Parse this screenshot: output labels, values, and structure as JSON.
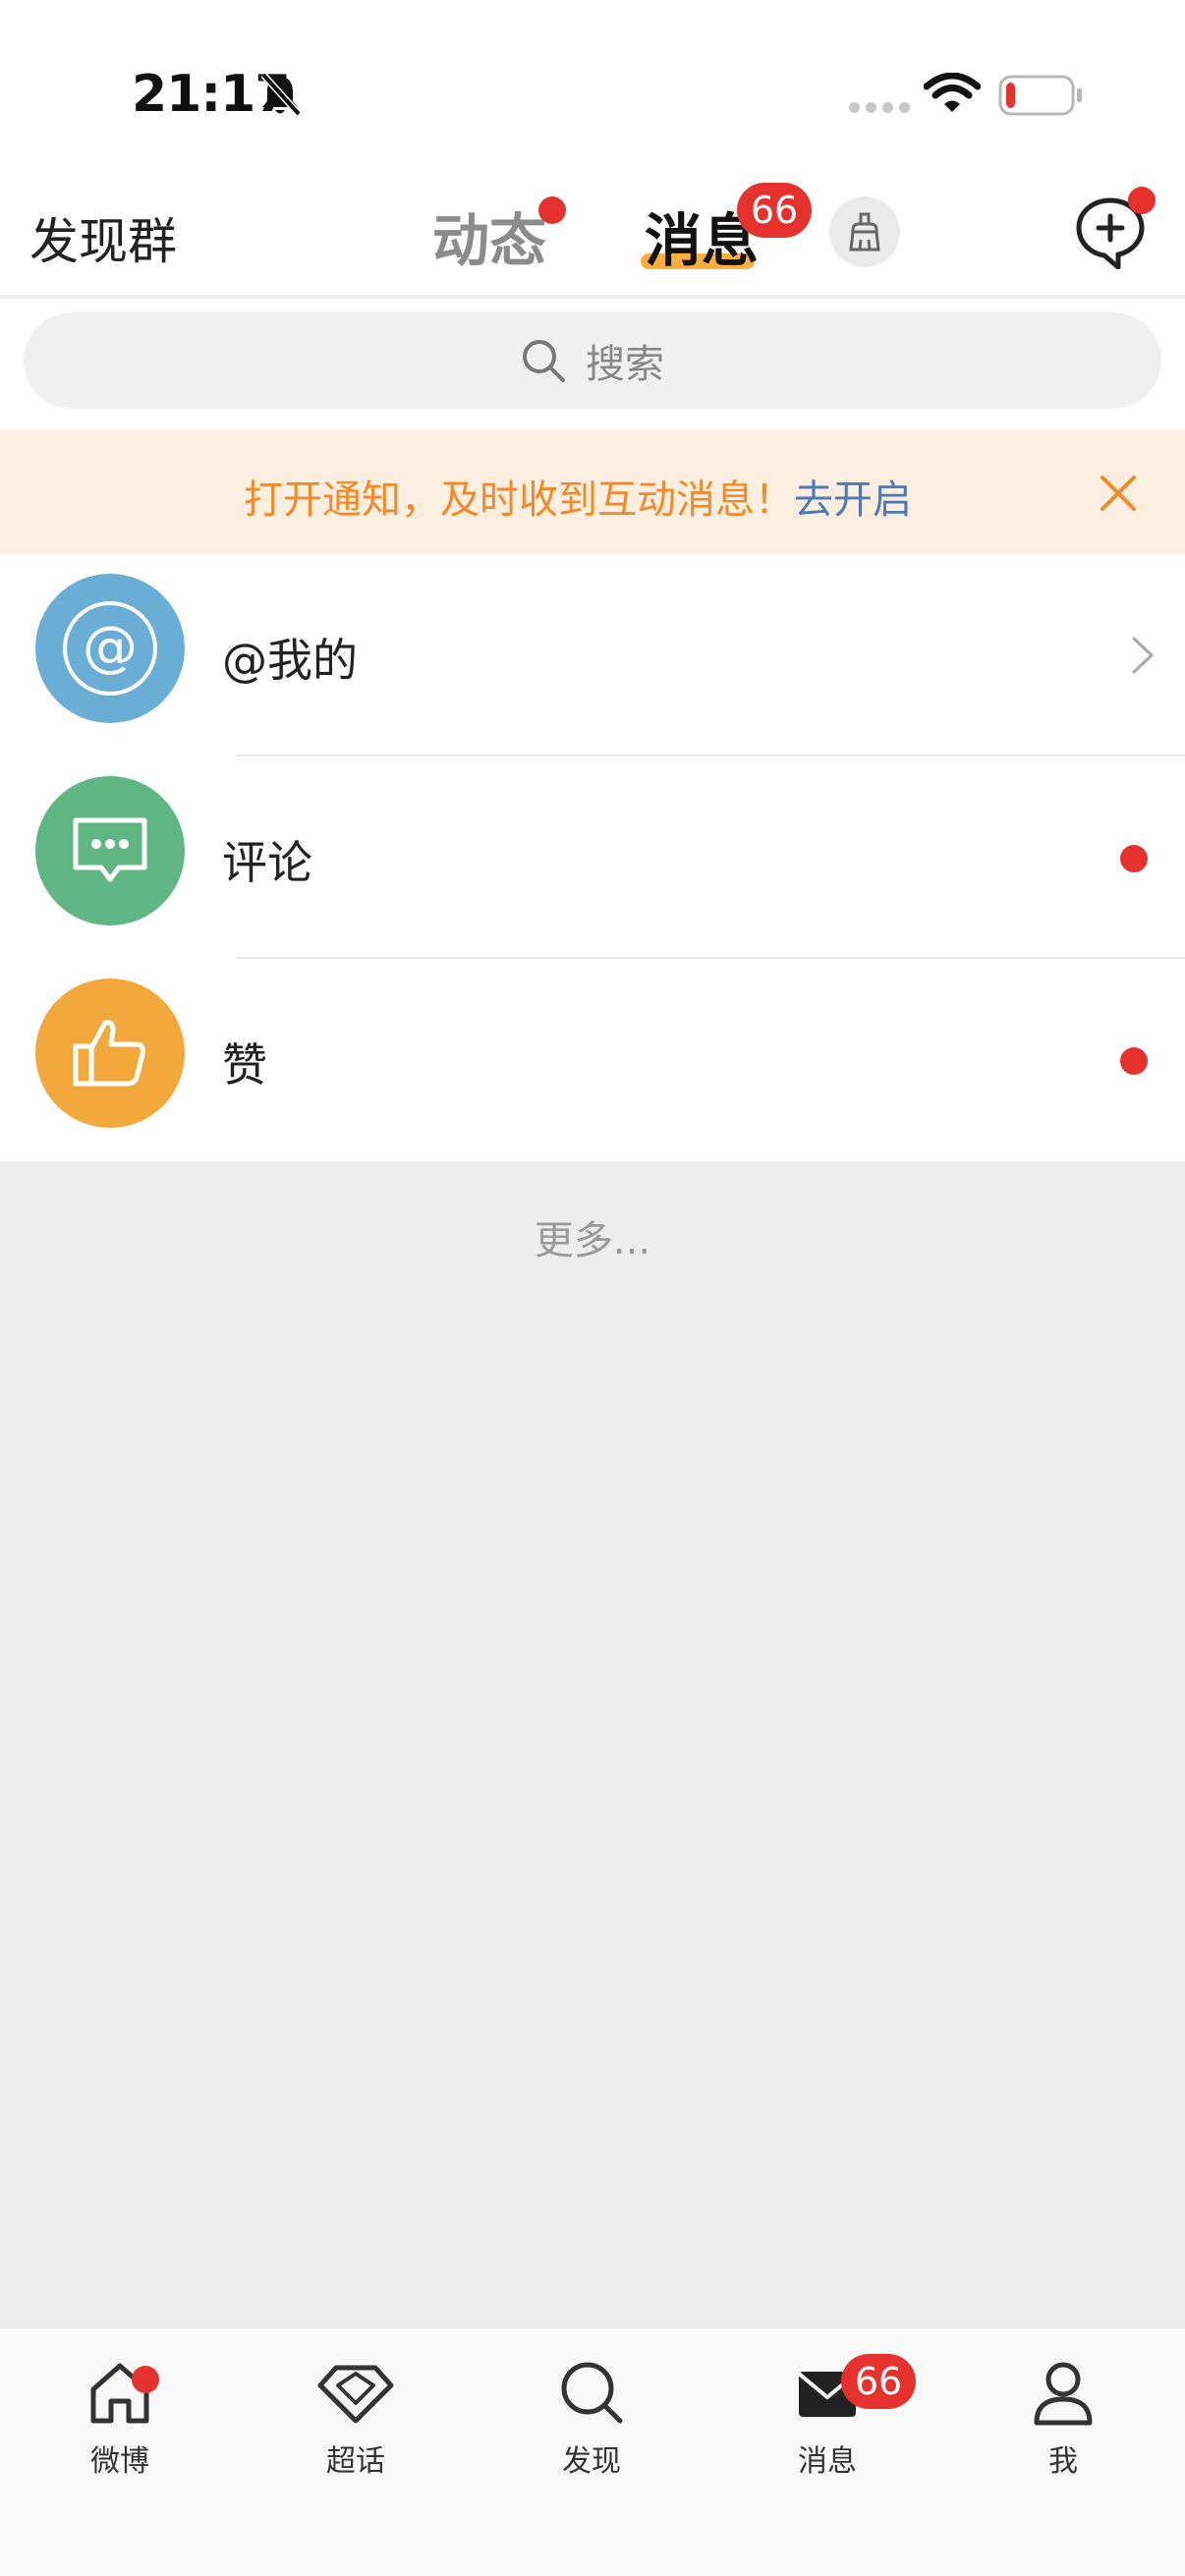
{
  "status_bar": {
    "time": "21:17",
    "icons": [
      "bell-muted-icon",
      "signal-icon",
      "wifi-icon",
      "battery-low-icon"
    ],
    "battery_level": 0.15
  },
  "top_nav": {
    "left_label": "发现群",
    "tabs": [
      {
        "label": "动态",
        "has_dot": true,
        "active": false
      },
      {
        "label": "消息",
        "badge": "66",
        "active": true
      }
    ],
    "clean_icon": "broom-icon",
    "compose_icon": "compose-chat-icon"
  },
  "search": {
    "placeholder": "搜索",
    "icon": "search-icon"
  },
  "notice": {
    "text": "打开通知，及时收到互动消息！",
    "link": "去开启",
    "close_icon": "close-icon"
  },
  "list": {
    "items": [
      {
        "label": "@我的",
        "icon": "at-icon",
        "color": "#6aaed6",
        "trailing": "chevron"
      },
      {
        "label": "评论",
        "icon": "comment-icon",
        "color": "#5fb682",
        "trailing": "dot"
      },
      {
        "label": "赞",
        "icon": "thumbs-up-icon",
        "color": "#f2a83b",
        "trailing": "dot"
      }
    ]
  },
  "more": "更多...",
  "tab_bar": {
    "items": [
      {
        "label": "微博",
        "icon": "home-icon",
        "has_dot": true
      },
      {
        "label": "超话",
        "icon": "diamond-icon"
      },
      {
        "label": "发现",
        "icon": "search-icon"
      },
      {
        "label": "消息",
        "icon": "envelope-icon",
        "badge": "66",
        "active": true
      },
      {
        "label": "我",
        "icon": "person-icon"
      }
    ]
  },
  "colors": {
    "accent_red": "#e6322e",
    "notice_text": "#f08a2c",
    "notice_link": "#4f79b4",
    "tab_underline": "#ffb03a"
  }
}
